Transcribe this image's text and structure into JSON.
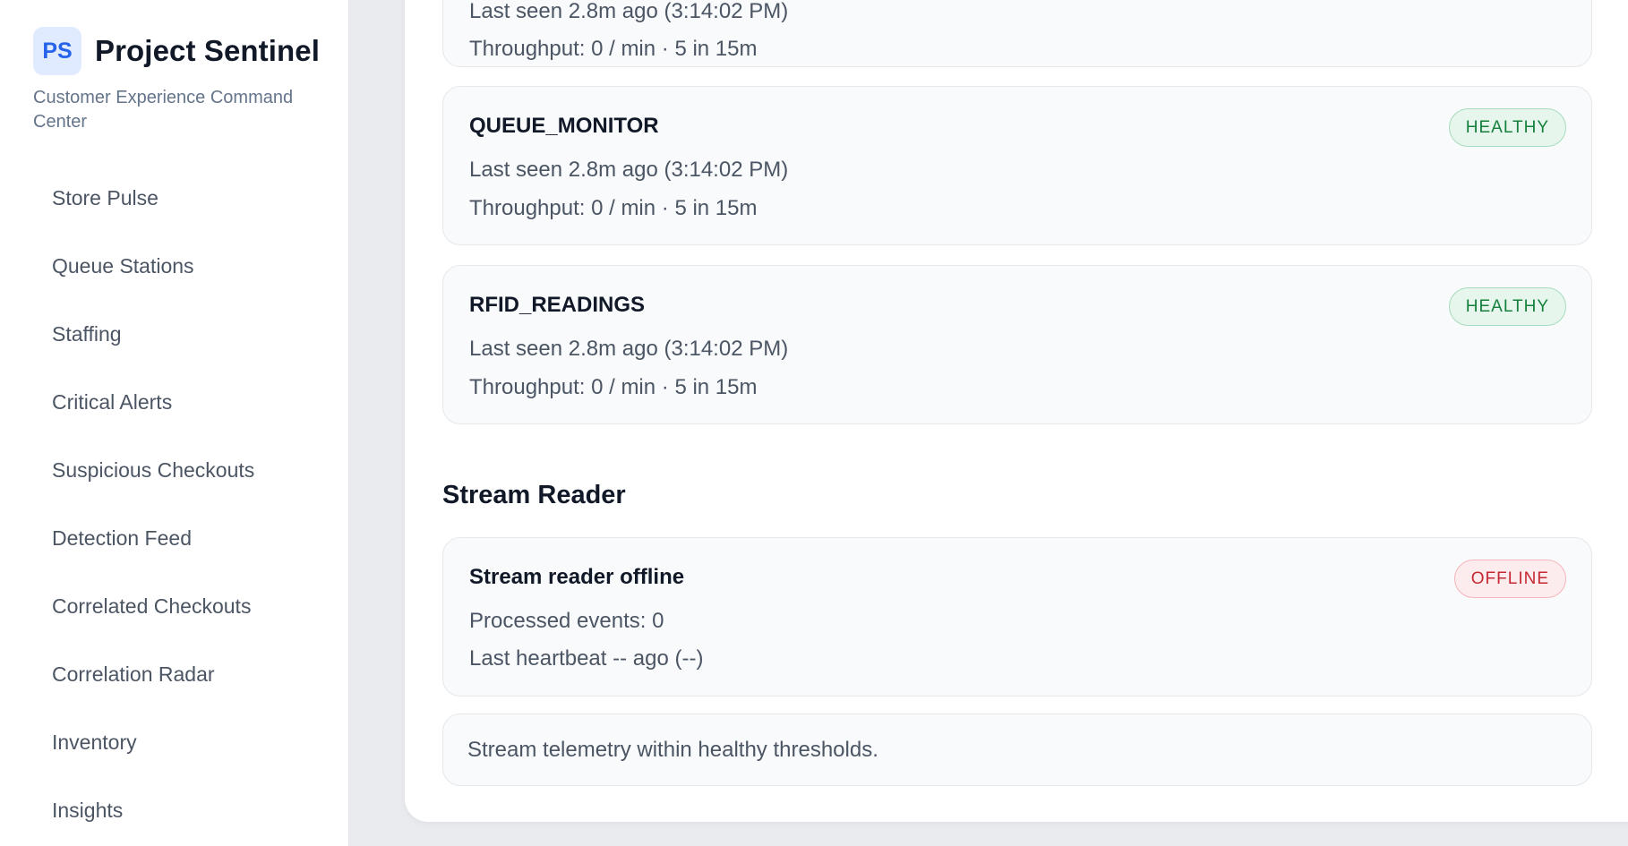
{
  "brand": {
    "logo_text": "PS",
    "name": "Project Sentinel",
    "subtitle": "Customer Experience Command Center"
  },
  "sidebar": {
    "items": [
      {
        "label": "Store Pulse"
      },
      {
        "label": "Queue Stations"
      },
      {
        "label": "Staffing"
      },
      {
        "label": "Critical Alerts"
      },
      {
        "label": "Suspicious Checkouts"
      },
      {
        "label": "Detection Feed"
      },
      {
        "label": "Correlated Checkouts"
      },
      {
        "label": "Correlation Radar"
      },
      {
        "label": "Inventory"
      },
      {
        "label": "Insights"
      }
    ]
  },
  "streams": [
    {
      "last_seen": "Last seen 2.8m ago (3:14:02 PM)",
      "throughput": "Throughput: 0 / min · 5 in 15m"
    },
    {
      "name": "QUEUE_MONITOR",
      "status": "HEALTHY",
      "last_seen": "Last seen 2.8m ago (3:14:02 PM)",
      "throughput": "Throughput: 0 / min · 5 in 15m"
    },
    {
      "name": "RFID_READINGS",
      "status": "HEALTHY",
      "last_seen": "Last seen 2.8m ago (3:14:02 PM)",
      "throughput": "Throughput: 0 / min · 5 in 15m"
    }
  ],
  "stream_reader": {
    "section_title": "Stream Reader",
    "title": "Stream reader offline",
    "status": "OFFLINE",
    "processed": "Processed events: 0",
    "heartbeat": "Last heartbeat -- ago (--)"
  },
  "telemetry_note": "Stream telemetry within healthy thresholds.",
  "colors": {
    "accent": "#2563eb",
    "healthy": "#15803d",
    "offline": "#c62833",
    "page_bg": "#e9ebef"
  }
}
